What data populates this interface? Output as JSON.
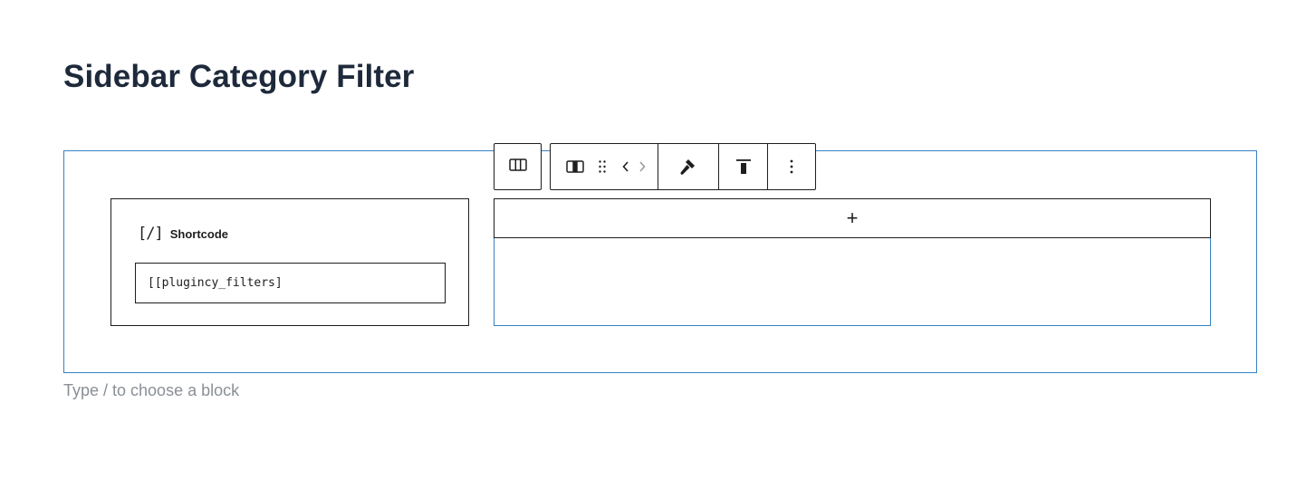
{
  "page": {
    "title": "Sidebar Category Filter",
    "hint": "Type / to choose a block"
  },
  "shortcode_block": {
    "icon_glyph": "[/]",
    "label": "Shortcode",
    "value": "[[plugincy_filters]"
  },
  "empty_column": {
    "appender_glyph": "+"
  },
  "toolbar": {
    "buttons": [
      {
        "name": "select-parent-columns",
        "icon": "columns-icon"
      },
      {
        "name": "block-type-column",
        "icon": "column-icon"
      },
      {
        "name": "drag-handle",
        "icon": "drag-handle-icon"
      },
      {
        "name": "move-left",
        "icon": "chevron-left-icon"
      },
      {
        "name": "move-right",
        "icon": "chevron-right-icon"
      },
      {
        "name": "styles",
        "icon": "paintbrush-icon"
      },
      {
        "name": "vertical-align",
        "icon": "align-top-icon"
      },
      {
        "name": "options",
        "icon": "more-vertical-icon"
      }
    ]
  },
  "colors": {
    "selection_border": "#3582c4",
    "text": "#1e1e1e",
    "title": "#1e2a3b",
    "hint": "#8a8f96"
  }
}
